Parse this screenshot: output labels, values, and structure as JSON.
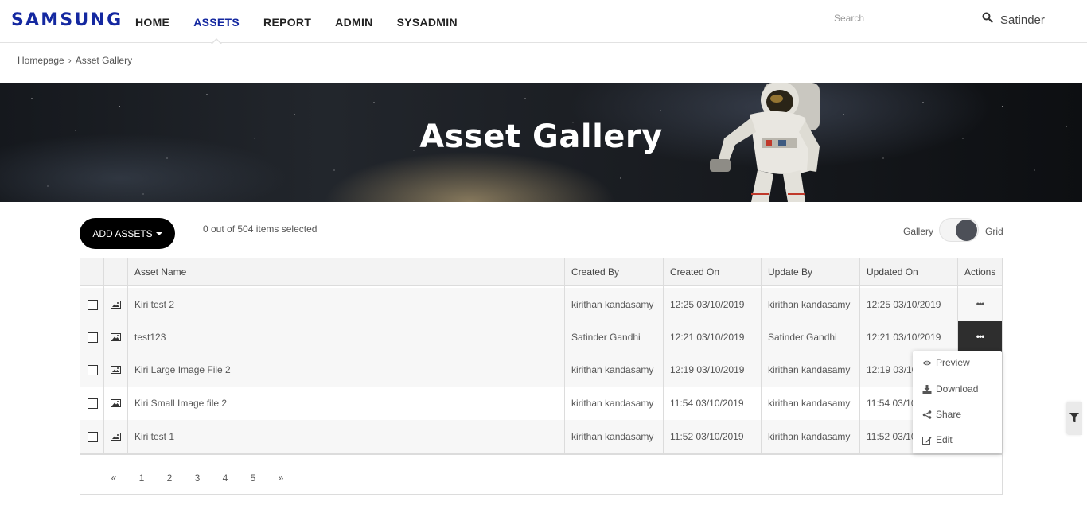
{
  "header": {
    "logo": "SAMSUNG",
    "nav": [
      {
        "label": "HOME",
        "active": false
      },
      {
        "label": "ASSETS",
        "active": true
      },
      {
        "label": "REPORT",
        "active": false
      },
      {
        "label": "ADMIN",
        "active": false
      },
      {
        "label": "SYSADMIN",
        "active": false
      }
    ],
    "search_placeholder": "Search",
    "search_value": "",
    "user_name": "Satinder"
  },
  "breadcrumb": {
    "items": [
      "Homepage",
      "Asset Gallery"
    ],
    "separator": "›"
  },
  "hero": {
    "title": "Asset Gallery"
  },
  "toolbar": {
    "add_assets_label": "ADD ASSETS",
    "selection_text": "0 out of 504 items selected",
    "view_toggle": {
      "left_label": "Gallery",
      "right_label": "Grid",
      "selected": "Grid"
    }
  },
  "table": {
    "columns": [
      "Asset Name",
      "Created By",
      "Created On",
      "Update By",
      "Updated On",
      "Actions"
    ],
    "rows": [
      {
        "name": "Kiri test 2",
        "created_by": "kirithan kandasamy",
        "created_on": "12:25 03/10/2019",
        "updated_by": "kirithan kandasamy",
        "updated_on": "12:25 03/10/2019",
        "checked": false
      },
      {
        "name": "test123",
        "created_by": "Satinder Gandhi",
        "created_on": "12:21 03/10/2019",
        "updated_by": "Satinder Gandhi",
        "updated_on": "12:21 03/10/2019",
        "checked": false
      },
      {
        "name": "Kiri Large Image File 2",
        "created_by": "kirithan kandasamy",
        "created_on": "12:19 03/10/2019",
        "updated_by": "kirithan kandasamy",
        "updated_on": "12:19 03/10",
        "checked": false
      },
      {
        "name": "Kiri Small Image file 2",
        "created_by": "kirithan kandasamy",
        "created_on": "11:54 03/10/2019",
        "updated_by": "kirithan kandasamy",
        "updated_on": "11:54 03/10",
        "checked": false
      },
      {
        "name": "Kiri test 1",
        "created_by": "kirithan kandasamy",
        "created_on": "11:52 03/10/2019",
        "updated_by": "kirithan kandasamy",
        "updated_on": "11:52 03/10",
        "checked": false
      }
    ],
    "actions_glyph": "•••",
    "open_actions_row": 1
  },
  "actions_menu": {
    "items": [
      {
        "label": "Preview",
        "icon": "eye-icon"
      },
      {
        "label": "Download",
        "icon": "download-icon"
      },
      {
        "label": "Share",
        "icon": "share-icon"
      },
      {
        "label": "Edit",
        "icon": "edit-icon"
      }
    ]
  },
  "pagination": {
    "prev": "«",
    "pages": [
      "1",
      "2",
      "3",
      "4",
      "5"
    ],
    "next": "»"
  },
  "colors": {
    "brand": "#1428a0",
    "button_bg": "#000000",
    "active_action_bg": "#2e2e2e"
  }
}
